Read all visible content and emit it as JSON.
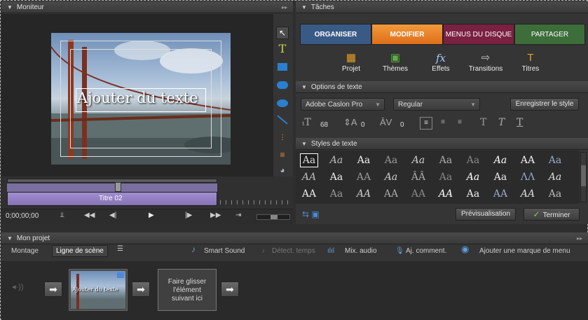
{
  "monitor": {
    "title": "Moniteur",
    "overlay_text": "Ajouter du texte",
    "clip_label": "Titre 02",
    "timecode": "0;00;00;00"
  },
  "tasks": {
    "title": "Tâches",
    "tabs": [
      {
        "label": "ORGANISER",
        "color": "#3a5a86"
      },
      {
        "label": "MODIFIER",
        "color": "#e67e22"
      },
      {
        "label": "MENUS DU DISQUE",
        "color": "#7a2040"
      },
      {
        "label": "PARTAGER",
        "color": "#3d6e3a"
      }
    ],
    "tools": [
      {
        "label": "Projet",
        "icon": "project-icon"
      },
      {
        "label": "Thèmes",
        "icon": "themes-icon"
      },
      {
        "label": "Effets",
        "icon": "effects-icon"
      },
      {
        "label": "Transitions",
        "icon": "transitions-icon"
      },
      {
        "label": "Titres",
        "icon": "titles-icon"
      }
    ]
  },
  "text_options": {
    "title": "Options de texte",
    "font": "Adobe Caslon Pro",
    "style": "Regular",
    "save_style": "Enregistrer le style",
    "size": "68",
    "leading": "0",
    "kerning": "0"
  },
  "text_styles": {
    "title": "Styles de texte",
    "preview": "Prévisualisation",
    "done": "Terminer"
  },
  "project": {
    "title": "Mon projet",
    "modes": [
      "Montage",
      "Ligne de scène"
    ],
    "toolbar": [
      "Smart Sound",
      "Détect. temps",
      "Mix. audio",
      "Aj. comment.",
      "Ajouter une marque de menu"
    ],
    "thumb_text": "Ajouter du texte",
    "drop_placeholder": "Faire glisser l'élément suivant ici"
  }
}
